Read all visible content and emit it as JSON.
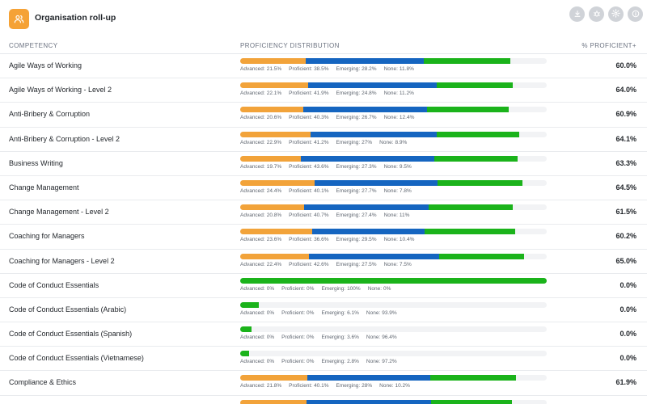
{
  "header": {
    "title": "Organisation roll-up",
    "icons": [
      "users-icon",
      "download-icon",
      "bug-icon",
      "settings-icon",
      "info-icon"
    ]
  },
  "columns": {
    "competency": "COMPETENCY",
    "distribution": "PROFICIENCY DISTRIBUTION",
    "proficient": "% PROFICIENT+"
  },
  "colors": {
    "advanced": "#f2a33a",
    "proficient": "#1565c0",
    "emerging": "#1bb31b",
    "accent": "#f5a236"
  },
  "legend_labels": {
    "advanced": "Advanced:",
    "proficient": "Proficient:",
    "emerging": "Emerging:",
    "none": "None:"
  },
  "rows": [
    {
      "name": "Agile Ways of Working",
      "advanced": 21.5,
      "proficient": 38.5,
      "emerging": 28.2,
      "none": 11.8,
      "adv_text": "21.5%",
      "prof_text": "38.5%",
      "emer_text": "28.2%",
      "none_text": "11.8%",
      "pct": "60.0%"
    },
    {
      "name": "Agile Ways of Working - Level 2",
      "advanced": 22.1,
      "proficient": 41.9,
      "emerging": 24.8,
      "none": 11.2,
      "adv_text": "22.1%",
      "prof_text": "41.9%",
      "emer_text": "24.8%",
      "none_text": "11.2%",
      "pct": "64.0%"
    },
    {
      "name": "Anti-Bribery & Corruption",
      "advanced": 20.6,
      "proficient": 40.3,
      "emerging": 26.7,
      "none": 12.4,
      "adv_text": "20.6%",
      "prof_text": "40.3%",
      "emer_text": "26.7%",
      "none_text": "12.4%",
      "pct": "60.9%"
    },
    {
      "name": "Anti-Bribery & Corruption - Level 2",
      "advanced": 22.9,
      "proficient": 41.2,
      "emerging": 27,
      "none": 8.9,
      "adv_text": "22.9%",
      "prof_text": "41.2%",
      "emer_text": "27%",
      "none_text": "8.9%",
      "pct": "64.1%"
    },
    {
      "name": "Business Writing",
      "advanced": 19.7,
      "proficient": 43.6,
      "emerging": 27.3,
      "none": 9.5,
      "adv_text": "19.7%",
      "prof_text": "43.6%",
      "emer_text": "27.3%",
      "none_text": "9.5%",
      "pct": "63.3%"
    },
    {
      "name": "Change Management",
      "advanced": 24.4,
      "proficient": 40.1,
      "emerging": 27.7,
      "none": 7.8,
      "adv_text": "24.4%",
      "prof_text": "40.1%",
      "emer_text": "27.7%",
      "none_text": "7.8%",
      "pct": "64.5%"
    },
    {
      "name": "Change Management - Level 2",
      "advanced": 20.8,
      "proficient": 40.7,
      "emerging": 27.4,
      "none": 11,
      "adv_text": "20.8%",
      "prof_text": "40.7%",
      "emer_text": "27.4%",
      "none_text": "11%",
      "pct": "61.5%"
    },
    {
      "name": "Coaching for Managers",
      "advanced": 23.6,
      "proficient": 36.6,
      "emerging": 29.5,
      "none": 10.4,
      "adv_text": "23.6%",
      "prof_text": "36.6%",
      "emer_text": "29.5%",
      "none_text": "10.4%",
      "pct": "60.2%"
    },
    {
      "name": "Coaching for Managers - Level 2",
      "advanced": 22.4,
      "proficient": 42.6,
      "emerging": 27.5,
      "none": 7.5,
      "adv_text": "22.4%",
      "prof_text": "42.6%",
      "emer_text": "27.5%",
      "none_text": "7.5%",
      "pct": "65.0%"
    },
    {
      "name": "Code of Conduct Essentials",
      "advanced": 0,
      "proficient": 0,
      "emerging": 100,
      "none": 0,
      "adv_text": "0%",
      "prof_text": "0%",
      "emer_text": "100%",
      "none_text": "0%",
      "pct": "0.0%"
    },
    {
      "name": "Code of Conduct Essentials (Arabic)",
      "advanced": 0,
      "proficient": 0,
      "emerging": 6.1,
      "none": 93.9,
      "adv_text": "0%",
      "prof_text": "0%",
      "emer_text": "6.1%",
      "none_text": "93.9%",
      "pct": "0.0%"
    },
    {
      "name": "Code of Conduct Essentials (Spanish)",
      "advanced": 0,
      "proficient": 0,
      "emerging": 3.6,
      "none": 96.4,
      "adv_text": "0%",
      "prof_text": "0%",
      "emer_text": "3.6%",
      "none_text": "96.4%",
      "pct": "0.0%"
    },
    {
      "name": "Code of Conduct Essentials (Vietnamese)",
      "advanced": 0,
      "proficient": 0,
      "emerging": 2.8,
      "none": 97.2,
      "adv_text": "0%",
      "prof_text": "0%",
      "emer_text": "2.8%",
      "none_text": "97.2%",
      "pct": "0.0%"
    },
    {
      "name": "Compliance & Ethics",
      "advanced": 21.8,
      "proficient": 40.1,
      "emerging": 28,
      "none": 10.2,
      "adv_text": "21.8%",
      "prof_text": "40.1%",
      "emer_text": "28%",
      "none_text": "10.2%",
      "pct": "61.9%"
    },
    {
      "name": "",
      "advanced": 21.7,
      "proficient": 40.6,
      "emerging": 26.4,
      "none": 11.3,
      "adv_text": "",
      "prof_text": "",
      "emer_text": "",
      "none_text": "",
      "pct": ""
    }
  ]
}
